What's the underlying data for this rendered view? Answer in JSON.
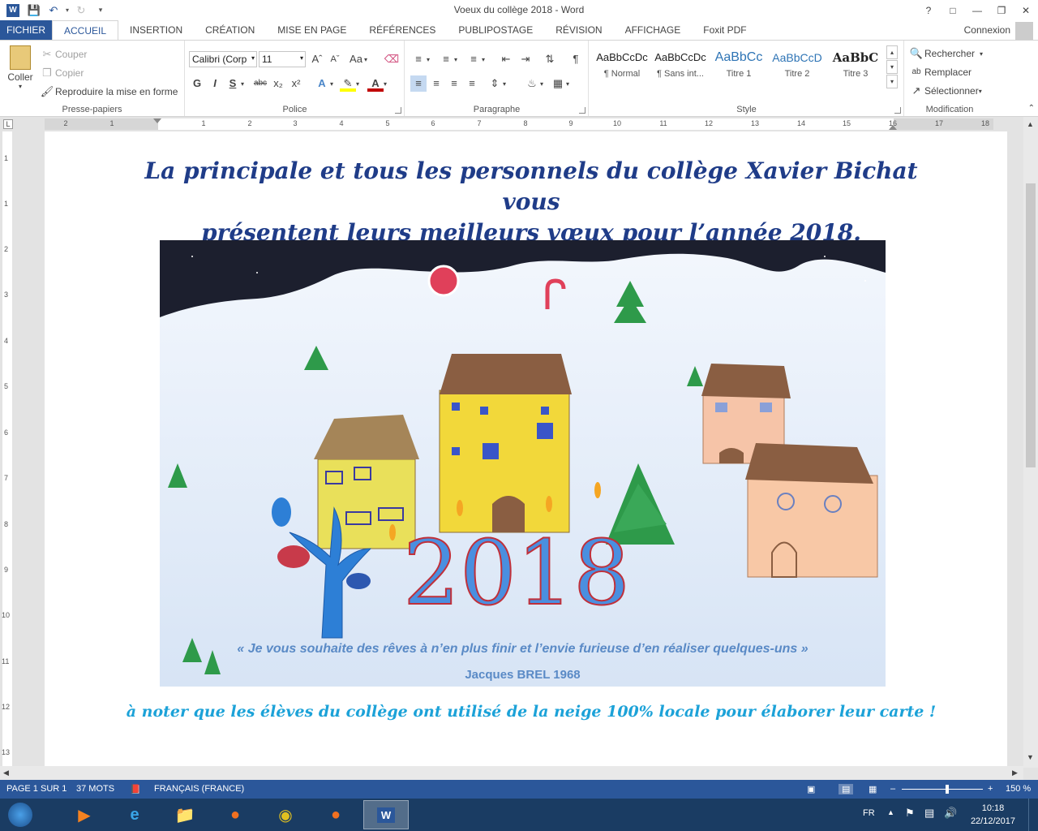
{
  "window": {
    "title": "Voeux du collège 2018 - Word",
    "help_icon": "?",
    "controls": [
      "ribbon-display-icon",
      "minimize-icon",
      "restore-icon",
      "close-icon"
    ]
  },
  "tabs": [
    {
      "label": "FICHIER"
    },
    {
      "label": "ACCUEIL"
    },
    {
      "label": "INSERTION"
    },
    {
      "label": "CRÉATION"
    },
    {
      "label": "MISE EN PAGE"
    },
    {
      "label": "RÉFÉRENCES"
    },
    {
      "label": "PUBLIPOSTAGE"
    },
    {
      "label": "RÉVISION"
    },
    {
      "label": "AFFICHAGE"
    },
    {
      "label": "Foxit PDF"
    }
  ],
  "signin": "Connexion",
  "ribbon": {
    "clipboard": {
      "label": "Presse-papiers",
      "paste": "Coller",
      "cut": "Couper",
      "copy": "Copier",
      "format_painter": "Reproduire la mise en forme"
    },
    "font": {
      "label": "Police",
      "font_name": "Calibri (Corp",
      "font_size": "11",
      "bold": "G",
      "italic": "I",
      "underline": "S",
      "strike": "abc",
      "subscript": "x₂",
      "superscript": "x²"
    },
    "paragraph": {
      "label": "Paragraphe"
    },
    "styles": {
      "label": "Style",
      "items": [
        {
          "sample": "AaBbCcDc",
          "name": "¶ Normal"
        },
        {
          "sample": "AaBbCcDc",
          "name": "¶ Sans int..."
        },
        {
          "sample": "AaBbCc",
          "name": "Titre 1"
        },
        {
          "sample": "AaBbCcD",
          "name": "Titre 2"
        },
        {
          "sample": "AaBbC",
          "name": "Titre 3"
        }
      ]
    },
    "editing": {
      "label": "Modification",
      "find": "Rechercher",
      "replace": "Remplacer",
      "select": "Sélectionner"
    }
  },
  "ruler": {
    "h_numbers": [
      "2",
      "1",
      "1",
      "2",
      "3",
      "4",
      "5",
      "6",
      "7",
      "8",
      "9",
      "10",
      "11",
      "12",
      "13",
      "14",
      "15",
      "16",
      "17",
      "18"
    ],
    "v_numbers": [
      "1",
      "1",
      "2",
      "3",
      "4",
      "5",
      "6",
      "7",
      "8",
      "9",
      "10",
      "11",
      "12",
      "13"
    ]
  },
  "document": {
    "headline_1": "La principale et tous les personnels du collège Xavier Bichat vous",
    "headline_2": "présentent leurs meilleurs vœux pour l’année 2018.",
    "card": {
      "year": "2018",
      "quote": "« Je vous souhaite des rêves à n’en plus finir et l’envie furieuse d’en réaliser quelques-uns »",
      "author": "Jacques BREL 1968"
    },
    "note": "à noter que les élèves du collège ont utilisé de la neige 100% locale pour élaborer leur carte !"
  },
  "status": {
    "page": "PAGE 1 SUR 1",
    "words": "37 MOTS",
    "language": "FRANÇAIS (FRANCE)",
    "zoom": "150 %",
    "zoom_level": 150
  },
  "taskbar": {
    "language": "FR",
    "time": "10:18",
    "date": "22/12/2017"
  }
}
